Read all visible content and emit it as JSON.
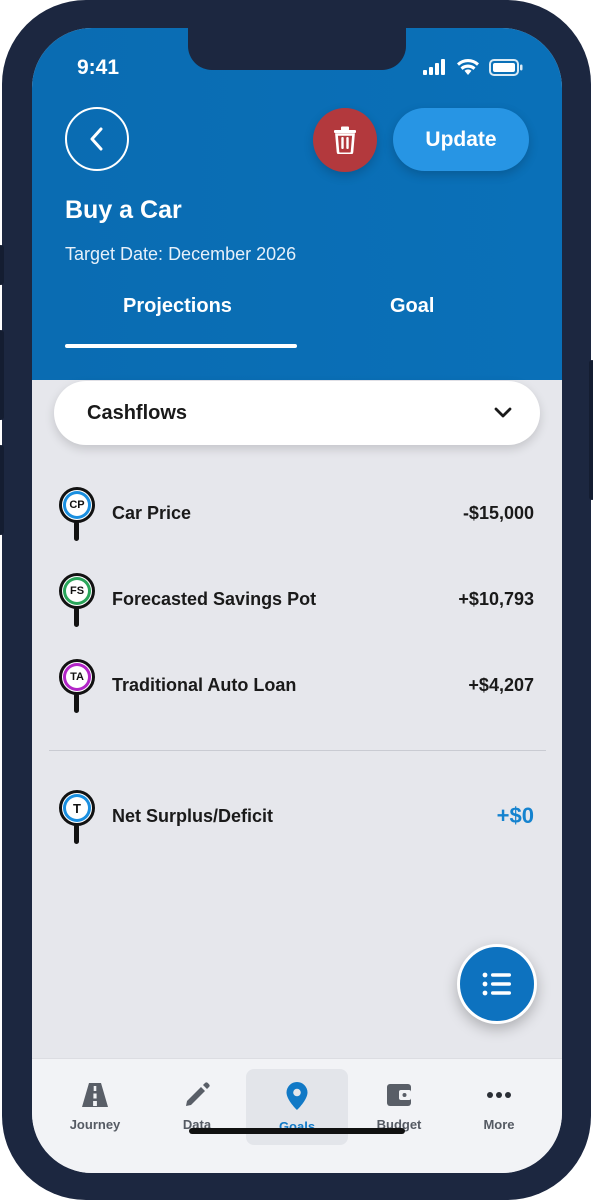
{
  "status": {
    "time": "9:41"
  },
  "header": {
    "update_label": "Update",
    "title": "Buy a Car",
    "target_date_label": "Target Date:",
    "target_date_value": "December 2026",
    "tabs": [
      {
        "label": "Projections",
        "active": true
      },
      {
        "label": "Goal",
        "active": false
      }
    ]
  },
  "dropdown": {
    "label": "Cashflows"
  },
  "cashflows": [
    {
      "code": "CP",
      "label": "Car Price",
      "amount": "-$15,000",
      "ring_color": "#1a8fe0"
    },
    {
      "code": "FS",
      "label": "Forecasted Savings Pot",
      "amount": "+$10,793",
      "ring_color": "#2aa65a"
    },
    {
      "code": "TA",
      "label": "Traditional Auto Loan",
      "amount": "+$4,207",
      "ring_color": "#b225c7"
    }
  ],
  "total": {
    "code": "T",
    "label": "Net Surplus/Deficit",
    "amount": "+$0",
    "ring_color": "#1a8fe0"
  },
  "bottom_nav": [
    {
      "label": "Journey",
      "icon": "road-icon",
      "active": false
    },
    {
      "label": "Data",
      "icon": "pencil-icon",
      "active": false
    },
    {
      "label": "Goals",
      "icon": "location-pin-icon",
      "active": true
    },
    {
      "label": "Budget",
      "icon": "wallet-icon",
      "active": false
    },
    {
      "label": "More",
      "icon": "more-dots-icon",
      "active": false
    }
  ],
  "colors": {
    "header_blue": "#0a6cb2",
    "delete_red": "#b3393d",
    "update_blue": "#2795e4",
    "accent_blue": "#1583cf"
  }
}
